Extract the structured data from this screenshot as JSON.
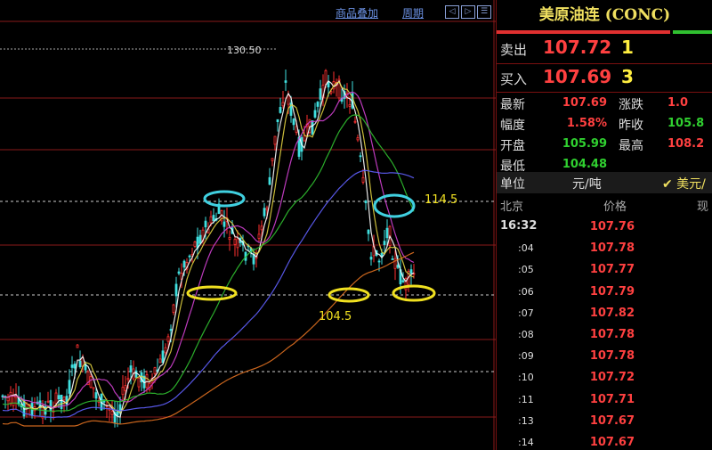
{
  "toolbar": {
    "overlay_label": "商品叠加",
    "period_label": "周期",
    "prev_btn": "◁",
    "next_btn": "▷",
    "menu_btn": "☰"
  },
  "chart_data": {
    "type": "candlestick",
    "annotations": {
      "high_marker": "130.50",
      "resistance": "114.5",
      "support": "104.5"
    },
    "reference_levels": [
      130.5,
      114.5,
      104.5
    ],
    "moving_averages": [
      {
        "color": "#ffffff"
      },
      {
        "color": "#e0d040"
      },
      {
        "color": "#d040d0"
      },
      {
        "color": "#30c030"
      },
      {
        "color": "#6060ff"
      },
      {
        "color": "#e07020"
      }
    ],
    "colors": {
      "up": "#ff3030",
      "down": "#40e0e0",
      "grid": "#8a1a1a",
      "circle_cyan": "#40d0e0",
      "circle_yellow": "#f0e020"
    }
  },
  "panel": {
    "title": "美原油连 (CONC)",
    "ask": {
      "label": "卖出",
      "price": "107.72",
      "vol": "1"
    },
    "bid": {
      "label": "买入",
      "price": "107.69",
      "vol": "3"
    },
    "stats": [
      {
        "label": "最新",
        "value": "107.69",
        "color": "#ff4040"
      },
      {
        "label": "涨跌",
        "value": "1.0",
        "color": "#ff4040"
      },
      {
        "label": "幅度",
        "value": "1.58%",
        "color": "#ff4040"
      },
      {
        "label": "昨收",
        "value": "105.8",
        "color": "#30d030"
      },
      {
        "label": "开盘",
        "value": "105.99",
        "color": "#30d030"
      },
      {
        "label": "最高",
        "value": "108.2",
        "color": "#ff4040"
      },
      {
        "label": "最低",
        "value": "104.48",
        "color": "#30d030"
      }
    ],
    "unit_label": "单位",
    "unit_value": "元/吨",
    "currency": "✔ 美元/",
    "tick_header": {
      "time": "北京",
      "price": "价格",
      "vol": "现"
    },
    "ticks": [
      {
        "time": "16:32",
        "price": "107.76"
      },
      {
        "time": ":04",
        "price": "107.78"
      },
      {
        "time": ":05",
        "price": "107.77"
      },
      {
        "time": ":06",
        "price": "107.79"
      },
      {
        "time": ":07",
        "price": "107.82"
      },
      {
        "time": ":08",
        "price": "107.78"
      },
      {
        "time": ":09",
        "price": "107.78"
      },
      {
        "time": ":10",
        "price": "107.72"
      },
      {
        "time": ":11",
        "price": "107.71"
      },
      {
        "time": ":13",
        "price": "107.67"
      },
      {
        "time": ":14",
        "price": "107.67"
      }
    ]
  }
}
